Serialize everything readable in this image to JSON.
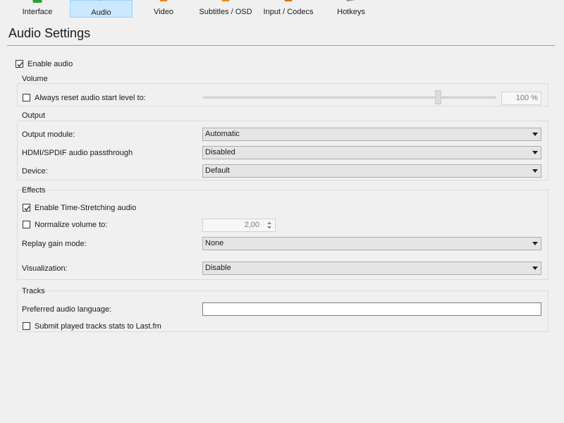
{
  "tabs": [
    {
      "label": "Interface",
      "active": false
    },
    {
      "label": "Audio",
      "active": true
    },
    {
      "label": "Video",
      "active": false
    },
    {
      "label": "Subtitles / OSD",
      "active": false
    },
    {
      "label": "Input / Codecs",
      "active": false
    },
    {
      "label": "Hotkeys",
      "active": false
    }
  ],
  "page_title": "Audio Settings",
  "enable_audio": {
    "label": "Enable audio",
    "checked": true
  },
  "volume": {
    "title": "Volume",
    "reset_label": "Always reset audio start level to:",
    "reset_checked": false,
    "level_text": "100 %",
    "level_fraction": 0.79
  },
  "output": {
    "title": "Output",
    "module_label": "Output module:",
    "module_value": "Automatic",
    "passthrough_label": "HDMI/SPDIF audio passthrough",
    "passthrough_value": "Disabled",
    "device_label": "Device:",
    "device_value": "Default"
  },
  "effects": {
    "title": "Effects",
    "timestretch_label": "Enable Time-Stretching audio",
    "timestretch_checked": true,
    "normalize_label": "Normalize volume to:",
    "normalize_checked": false,
    "normalize_value": "2,00",
    "replay_label": "Replay gain mode:",
    "replay_value": "None",
    "visualization_label": "Visualization:",
    "visualization_value": "Disable"
  },
  "tracks": {
    "title": "Tracks",
    "language_label": "Preferred audio language:",
    "language_value": "",
    "lastfm_label": "Submit played tracks stats to Last.fm",
    "lastfm_checked": false
  },
  "colors": {
    "active_tab_bg": "#cce8ff",
    "active_tab_border": "#99d1ff",
    "window_bg": "#f0f0f0"
  }
}
